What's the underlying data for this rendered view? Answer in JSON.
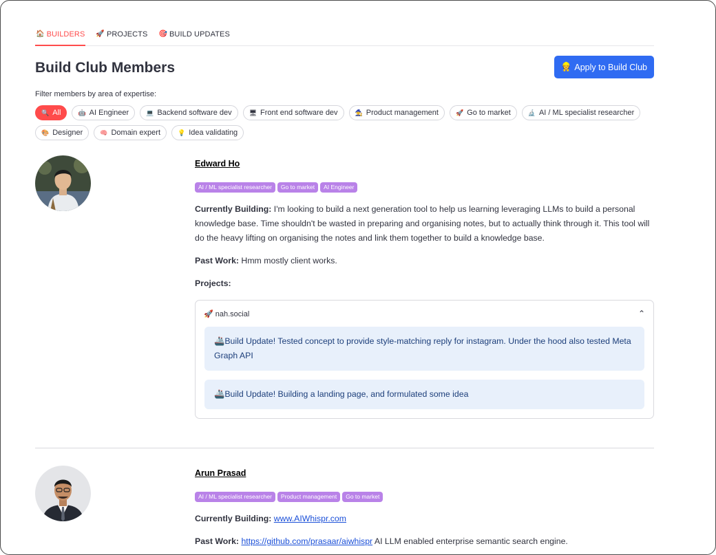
{
  "tabs": [
    {
      "icon": "🏠",
      "label": "BUILDERS",
      "active": true
    },
    {
      "icon": "🚀",
      "label": "PROJECTS",
      "active": false
    },
    {
      "icon": "🎯",
      "label": "BUILD UPDATES",
      "active": false
    }
  ],
  "header": {
    "title": "Build Club Members",
    "apply_icon": "👷",
    "apply_label": "Apply to Build Club"
  },
  "filter": {
    "label": "Filter members by area of expertise:",
    "chips": [
      {
        "icon": "🔍",
        "label": "All",
        "active": true
      },
      {
        "icon": "🤖",
        "label": "AI Engineer"
      },
      {
        "icon": "💻",
        "label": "Backend software dev"
      },
      {
        "icon": "🖥",
        "label": "Front end software dev"
      },
      {
        "icon": "🧙",
        "label": "Product management"
      },
      {
        "icon": "🚀",
        "label": "Go to market"
      },
      {
        "icon": "🔬",
        "label": "AI / ML specialist researcher"
      },
      {
        "icon": "🎨",
        "label": "Designer"
      },
      {
        "icon": "🧠",
        "label": "Domain expert"
      },
      {
        "icon": "💡",
        "label": "Idea validating"
      }
    ]
  },
  "members": [
    {
      "name": "Edward Ho",
      "tags": [
        "AI / ML specialist researcher",
        "Go to market",
        "AI Engineer"
      ],
      "building_label": "Currently Building:",
      "building_text": " I'm looking to build a next generation tool to help us learning leveraging LLMs to build a personal knowledge base. Time shouldn't be wasted in preparing and organising notes, but to actually think through it. This tool will do the heavy lifting on organising the notes and link them together to build a knowledge base.",
      "past_label": "Past Work:",
      "past_text": " Hmm mostly client works.",
      "projects_label": "Projects:",
      "project": {
        "icon": "🚀",
        "name": "nah.social",
        "chevron": "⌃",
        "updates": [
          {
            "icon": "🚢",
            "text": "Build Update! Tested concept to provide style-matching reply for instagram. Under the hood also tested Meta Graph API"
          },
          {
            "icon": "🚢",
            "text": "Build Update! Building a landing page, and formulated some idea"
          }
        ]
      }
    },
    {
      "name": "Arun Prasad",
      "tags": [
        "AI / ML specialist researcher",
        "Product management",
        "Go to market"
      ],
      "building_label": "Currently Building:",
      "building_link": "www.AIWhispr.com",
      "past_label": "Past Work:",
      "past_link": "https://github.com/prasaar/aiwhispr",
      "past_text": " AI LLM enabled enterprise semantic search engine."
    }
  ]
}
